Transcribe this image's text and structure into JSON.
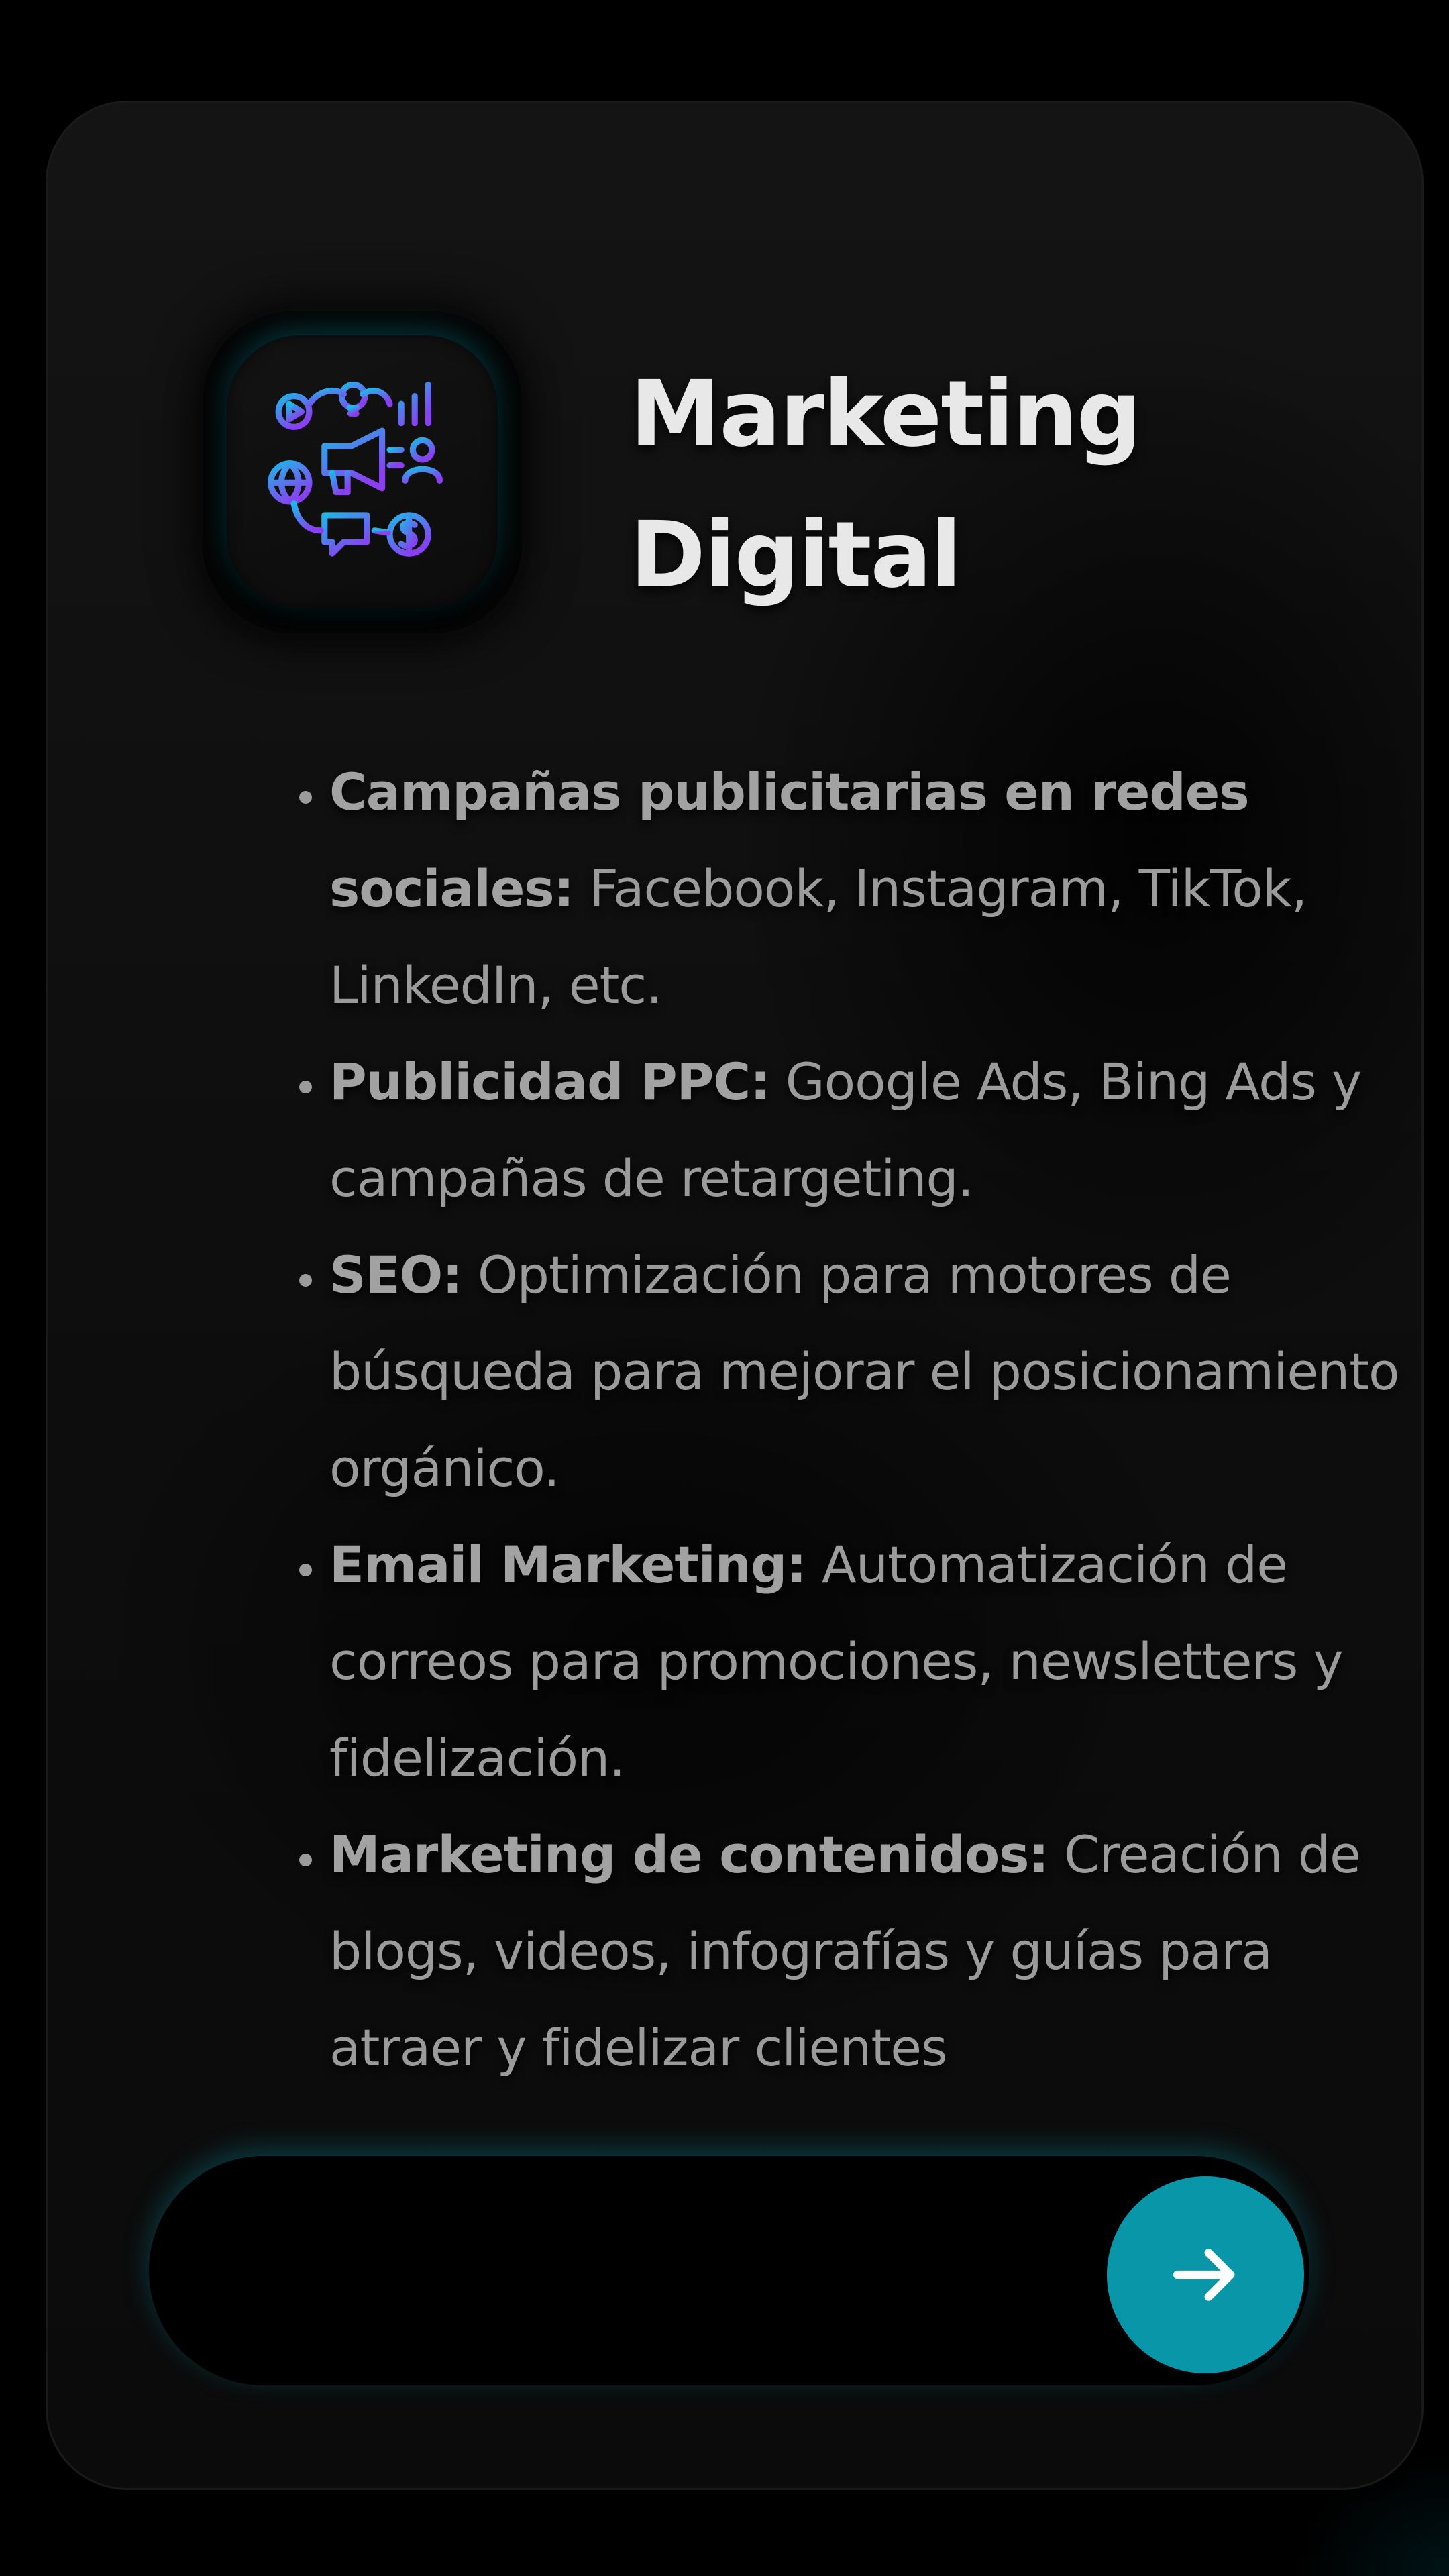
{
  "card": {
    "title_line1": "Marketing",
    "title_line2": "Digital",
    "icon": "digital-marketing-icon",
    "icon_gradient": [
      "#1fb6e8",
      "#8a3ff0"
    ]
  },
  "features": [
    {
      "bold": "Campañas publicitarias en redes sociales:",
      "text": " Facebook, Instagram, TikTok, LinkedIn, etc."
    },
    {
      "bold": "Publicidad PPC:",
      "text": " Google Ads, Bing Ads y campañas de retargeting."
    },
    {
      "bold": "SEO:",
      "text": " Optimización para motores de búsqueda para mejorar el posicionamiento orgánico."
    },
    {
      "bold": "Email Marketing:",
      "text": " Automatización de correos para promociones, newsletters y fidelización."
    },
    {
      "bold": "Marketing de contenidos:",
      "text": " Creación de blogs, videos, infografías y guías para atraer y fidelizar clientes"
    }
  ],
  "action": {
    "button_icon": "arrow-right-icon",
    "button_color": "#0a96a9"
  },
  "colors": {
    "background": "#000000",
    "card": "#111111",
    "title": "#e8e8e8",
    "body_text": "#9b9b9b",
    "accent_glow": "#00aabe"
  }
}
